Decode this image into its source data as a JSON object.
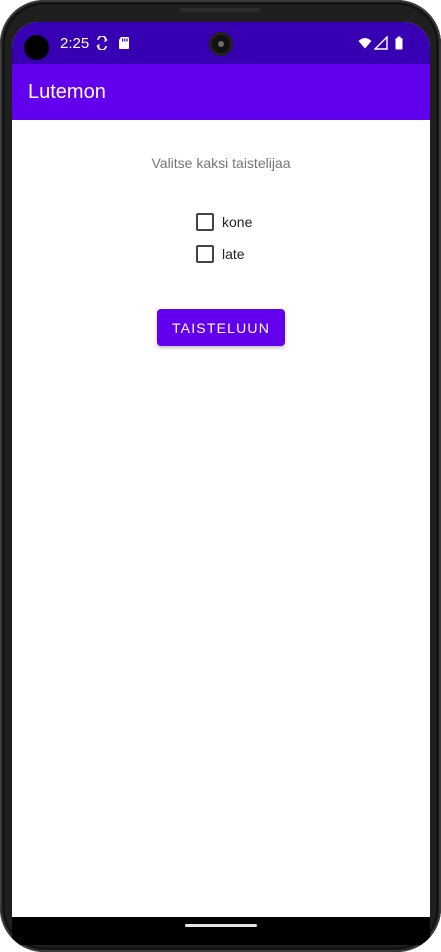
{
  "status_bar": {
    "time": "2:25",
    "icons": [
      "sync-icon",
      "sd-card-icon",
      "wifi-icon",
      "signal-icon",
      "battery-icon"
    ]
  },
  "app_bar": {
    "title": "Lutemon"
  },
  "main": {
    "instruction": "Valitse kaksi taistelijaa",
    "checkboxes": [
      {
        "label": "kone",
        "checked": false
      },
      {
        "label": "late",
        "checked": false
      }
    ],
    "fight_button_label": "TAISTELUUN"
  },
  "colors": {
    "status_bar": "#3700b3",
    "app_bar": "#6200ee",
    "button": "#6200ee"
  }
}
